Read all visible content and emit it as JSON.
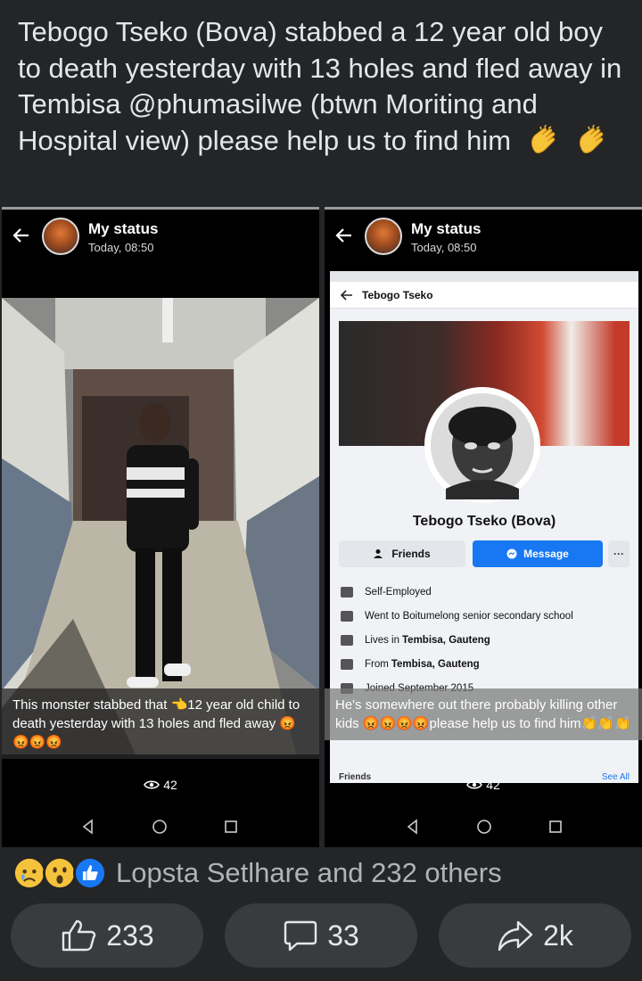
{
  "post": {
    "text": "Tebogo Tseko (Bova) stabbed a 12 year old boy to death yesterday with 13 holes and fled away in Tembisa @phumasilwe (btwn Moriting and Hospital view) please help us to find him"
  },
  "left_status": {
    "title": "My status",
    "time": "Today, 08:50",
    "caption": "This monster stabbed that 👈12 year old child to death yesterday with 13 holes and fled away 😡😡😡😡",
    "views": "42"
  },
  "right_status": {
    "title": "My status",
    "time": "Today, 08:50",
    "caption": "He's somewhere out there probably killing other kids 😡😡😡😡please help us to find him👏👏👏",
    "views": "42",
    "profile": {
      "header_name": "Tebogo Tseko",
      "name": "Tebogo Tseko (Bova)",
      "friends_btn": "Friends",
      "message_btn": "Message",
      "more_btn": "···",
      "info": [
        {
          "icon": "briefcase-icon",
          "text": "Self-Employed",
          "bold": ""
        },
        {
          "icon": "graduation-cap-icon",
          "text": "Went to Boitumelong senior secondary school",
          "bold": ""
        },
        {
          "icon": "home-icon",
          "text": "Lives in",
          "bold": "Tembisa, Gauteng"
        },
        {
          "icon": "location-pin-icon",
          "text": "From",
          "bold": "Tembisa, Gauteng"
        },
        {
          "icon": "clock-icon",
          "text": "Joined September 2015",
          "bold": ""
        }
      ],
      "friends_label": "Friends",
      "see_all": "See All"
    }
  },
  "reactions": {
    "summary": "Lopsta Setlhare and 232 others",
    "icons": [
      "sad-react-icon",
      "wow-react-icon",
      "like-react-icon"
    ]
  },
  "actions": {
    "like_count": "233",
    "comment_count": "33",
    "share_count": "2k"
  },
  "colors": {
    "background": "#242526",
    "button": "#3a3b3c",
    "text": "#e4e6eb",
    "muted": "#b0b3b8",
    "fb_blue": "#1877f2"
  }
}
